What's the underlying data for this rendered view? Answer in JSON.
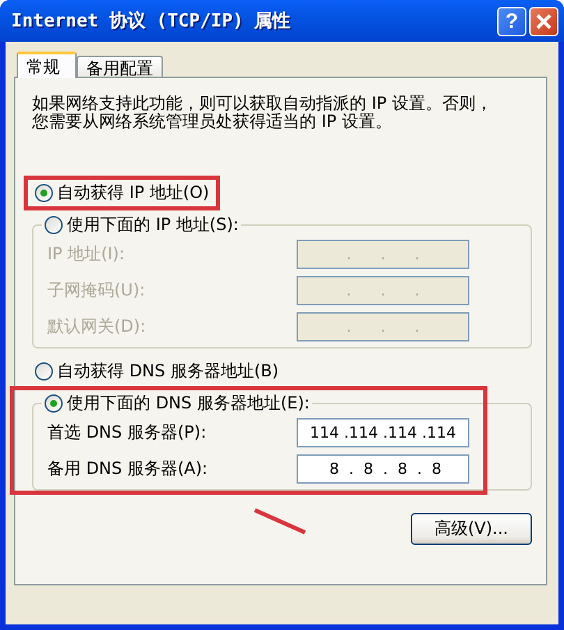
{
  "window": {
    "title": "Internet 协议 (TCP/IP) 属性",
    "help_button": "?"
  },
  "tabs": [
    {
      "label": "常规",
      "selected": true
    },
    {
      "label": "备用配置",
      "selected": false
    }
  ],
  "intro": "如果网络支持此功能，则可以获取自动指派的 IP 设置。否则，您需要从网络系统管理员处获得适当的 IP 设置。",
  "ip_section": {
    "auto_option": {
      "label": "自动获得 IP 地址(O)",
      "selected": true,
      "highlighted": true
    },
    "manual_group": {
      "label": "使用下面的 IP 地址(S):",
      "selected": false,
      "highlighted": false,
      "rows": [
        {
          "label": "IP 地址(I):",
          "value": ".      .      .",
          "disabled": true
        },
        {
          "label": "子网掩码(U):",
          "value": ".      .      .",
          "disabled": true
        },
        {
          "label": "默认网关(D):",
          "value": ".      .      .",
          "disabled": true
        }
      ]
    }
  },
  "dns_section": {
    "auto_option": {
      "label": "自动获得 DNS 服务器地址(B)",
      "selected": false,
      "highlighted": false
    },
    "manual_group": {
      "label": "使用下面的 DNS 服务器地址(E):",
      "selected": true,
      "highlighted": true,
      "rows": [
        {
          "label": "首选 DNS 服务器(P):",
          "value": "114 .114 .114 .114",
          "disabled": false
        },
        {
          "label": "备用 DNS 服务器(A):",
          "value": " 8  .  8  .  8  .  8",
          "disabled": false
        }
      ]
    }
  },
  "advanced_button": {
    "label": "高级(V)...",
    "arrow": true
  }
}
